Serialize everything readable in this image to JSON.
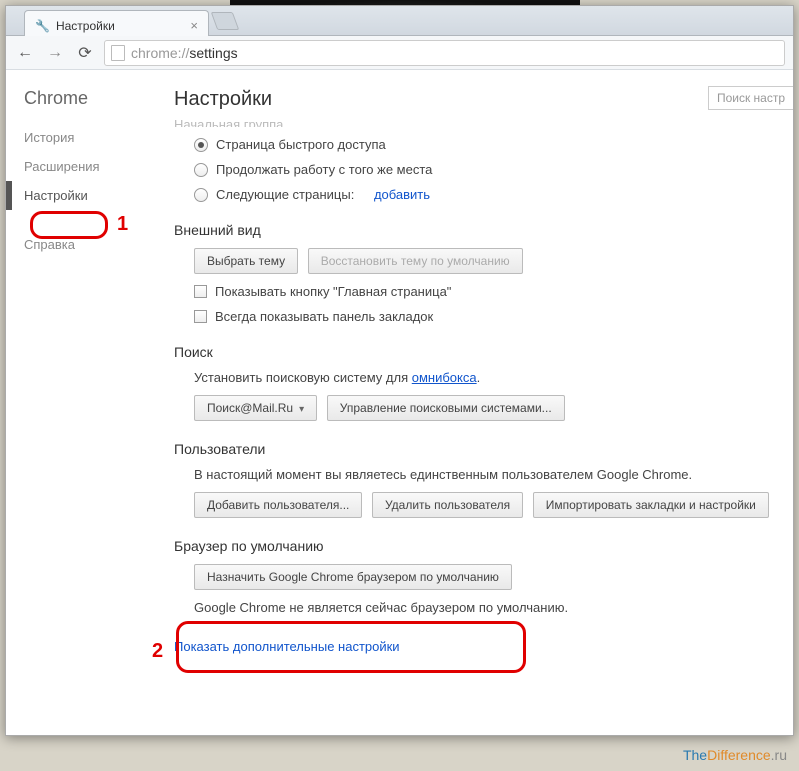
{
  "tab": {
    "title": "Настройки"
  },
  "omnibox": {
    "prefix": "chrome://",
    "path": "settings"
  },
  "sidebar": {
    "brand": "Chrome",
    "items": [
      {
        "label": "История"
      },
      {
        "label": "Расширения"
      },
      {
        "label": "Настройки"
      },
      {
        "label": "Справка"
      }
    ]
  },
  "page": {
    "title": "Настройки",
    "search_placeholder": "Поиск настр"
  },
  "startup": {
    "heading": "Начальная группа",
    "opt_fast": "Страница быстрого доступа",
    "opt_continue": "Продолжать работу с того же места",
    "opt_pages": "Следующие страницы:",
    "add_link": "добавить"
  },
  "appearance": {
    "heading": "Внешний вид",
    "choose_theme": "Выбрать тему",
    "reset_theme": "Восстановить тему по умолчанию",
    "show_home": "Показывать кнопку \"Главная страница\"",
    "show_bookmarks": "Всегда показывать панель закладок"
  },
  "search": {
    "heading": "Поиск",
    "desc_prefix": "Установить поисковую систему для ",
    "omnibox_link": "омнибокса",
    "engine": "Поиск@Mail.Ru",
    "manage": "Управление поисковыми системами..."
  },
  "users": {
    "heading": "Пользователи",
    "desc": "В настоящий момент вы являетесь единственным пользователем Google Chrome.",
    "add": "Добавить пользователя...",
    "delete": "Удалить пользователя",
    "import": "Импортировать закладки и настройки"
  },
  "default_browser": {
    "heading": "Браузер по умолчанию",
    "set_default": "Назначить Google Chrome браузером по умолчанию",
    "status": "Google Chrome не является сейчас браузером по умолчанию."
  },
  "advanced_link": "Показать дополнительные настройки",
  "annotations": {
    "one": "1",
    "two": "2"
  },
  "watermark": {
    "a": "The",
    "b": "Difference",
    "c": ".ru"
  }
}
